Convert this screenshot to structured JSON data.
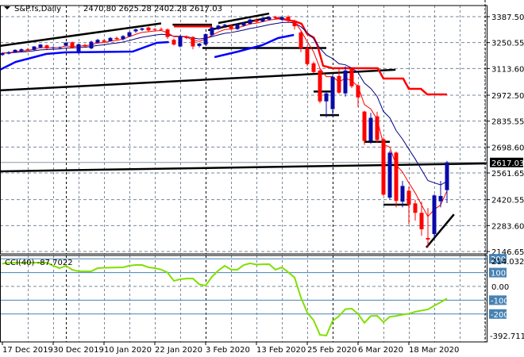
{
  "header": {
    "symbol_timeframe": "S&P.fs,Daily",
    "ohlc": "2470.80 2625.28 2402.28 2617.03"
  },
  "chart_data": {
    "type": "candlestick",
    "title": "S&P.fs,Daily",
    "colors": {
      "bull": "#0a0aa8",
      "bear": "#ff0000",
      "fast_ma": "#ff0000",
      "slow_ma": "#000080",
      "thick_blue": "#0000ff",
      "thick_red": "#ff0000",
      "cci": "#7fe000",
      "cci_level": "#4682b4",
      "grid": "#778899",
      "lines": "#000000"
    },
    "price_axis": {
      "ylim": [
        2146.65,
        3387.5
      ],
      "tick_labels": [
        "3387.50",
        "3250.55",
        "3113.60",
        "2972.50",
        "2835.55",
        "2698.60",
        "2561.65",
        "2420.55",
        "2283.60",
        "2146.65"
      ],
      "current_price": "2617.03"
    },
    "x_labels": [
      {
        "label": "17 Dec 2019",
        "bar": 0
      },
      {
        "label": "30 Dec 2019",
        "bar": 8
      },
      {
        "label": "10 Jan 2020",
        "bar": 16
      },
      {
        "label": "22 Jan 2020",
        "bar": 24
      },
      {
        "label": "3 Feb 2020",
        "bar": 32
      },
      {
        "label": "13 Feb 2020",
        "bar": 40
      },
      {
        "label": "25 Feb 2020",
        "bar": 48
      },
      {
        "label": "6 Mar 2020",
        "bar": 56
      },
      {
        "label": "18 Mar 2020",
        "bar": 64
      }
    ],
    "bars_ohlc": [
      [
        3185,
        3200,
        3180,
        3195
      ],
      [
        3192,
        3205,
        3188,
        3200
      ],
      [
        3200,
        3215,
        3196,
        3212
      ],
      [
        3205,
        3220,
        3200,
        3215
      ],
      [
        3215,
        3222,
        3208,
        3214
      ],
      [
        3212,
        3232,
        3208,
        3230
      ],
      [
        3225,
        3243,
        3220,
        3240
      ],
      [
        3236,
        3240,
        3215,
        3220
      ],
      [
        3224,
        3230,
        3215,
        3226
      ],
      [
        3222,
        3230,
        3218,
        3226
      ],
      [
        3235,
        3253,
        3230,
        3250
      ],
      [
        3252,
        3256,
        3218,
        3222
      ],
      [
        3205,
        3245,
        3190,
        3242
      ],
      [
        3238,
        3244,
        3225,
        3230
      ],
      [
        3220,
        3260,
        3215,
        3255
      ],
      [
        3250,
        3270,
        3245,
        3265
      ],
      [
        3262,
        3268,
        3250,
        3255
      ],
      [
        3258,
        3280,
        3255,
        3275
      ],
      [
        3275,
        3282,
        3265,
        3268
      ],
      [
        3268,
        3290,
        3262,
        3285
      ],
      [
        3283,
        3310,
        3280,
        3305
      ],
      [
        3310,
        3325,
        3302,
        3320
      ],
      [
        3318,
        3330,
        3312,
        3325
      ],
      [
        3330,
        3335,
        3310,
        3315
      ],
      [
        3322,
        3328,
        3315,
        3320
      ],
      [
        3322,
        3330,
        3312,
        3318
      ],
      [
        3320,
        3325,
        3270,
        3280
      ],
      [
        3265,
        3272,
        3235,
        3240
      ],
      [
        3230,
        3290,
        3225,
        3283
      ],
      [
        3282,
        3288,
        3268,
        3274
      ],
      [
        3280,
        3284,
        3215,
        3230
      ],
      [
        3233,
        3250,
        3225,
        3245
      ],
      [
        3240,
        3300,
        3236,
        3295
      ],
      [
        3290,
        3335,
        3285,
        3330
      ],
      [
        3322,
        3345,
        3318,
        3340
      ],
      [
        3340,
        3350,
        3330,
        3345
      ],
      [
        3340,
        3348,
        3318,
        3325
      ],
      [
        3322,
        3350,
        3318,
        3345
      ],
      [
        3340,
        3360,
        3335,
        3355
      ],
      [
        3350,
        3378,
        3345,
        3372
      ],
      [
        3370,
        3380,
        3352,
        3360
      ],
      [
        3362,
        3385,
        3358,
        3378
      ],
      [
        3372,
        3390,
        3368,
        3385
      ],
      [
        3385,
        3392,
        3375,
        3383
      ],
      [
        3372,
        3390,
        3368,
        3385
      ],
      [
        3387,
        3395,
        3355,
        3366
      ],
      [
        3366,
        3372,
        3320,
        3337
      ],
      [
        3304,
        3310,
        3200,
        3220
      ],
      [
        3220,
        3235,
        3125,
        3137
      ],
      [
        3141,
        3150,
        3090,
        3095
      ],
      [
        3103,
        3110,
        2930,
        2940
      ],
      [
        2940,
        2990,
        2855,
        2982
      ],
      [
        2899,
        3080,
        2860,
        3070
      ],
      [
        3074,
        3115,
        2980,
        2986
      ],
      [
        2982,
        3125,
        2965,
        3103
      ],
      [
        3112,
        3118,
        3010,
        3020
      ],
      [
        3024,
        3030,
        2910,
        2961
      ],
      [
        2886,
        2890,
        2710,
        2731
      ],
      [
        2731,
        2880,
        2715,
        2853
      ],
      [
        2861,
        2885,
        2720,
        2736
      ],
      [
        2740,
        2750,
        2440,
        2447
      ],
      [
        2431,
        2680,
        2420,
        2669
      ],
      [
        2669,
        2675,
        2380,
        2414
      ],
      [
        2410,
        2520,
        2380,
        2493
      ],
      [
        2468,
        2490,
        2290,
        2393
      ],
      [
        2401,
        2420,
        2310,
        2351
      ],
      [
        2351,
        2410,
        2230,
        2264
      ],
      [
        2218,
        2376,
        2168,
        2210
      ],
      [
        2239,
        2450,
        2215,
        2443
      ],
      [
        2412,
        2520,
        2380,
        2440
      ],
      [
        2470.8,
        2625.28,
        2402.28,
        2617.03
      ]
    ],
    "thick_blue_line": [
      [
        [
          -0.4,
          3106.6
        ],
        [
          2.1,
          3148.4
        ],
        [
          5,
          3173.7
        ],
        [
          6.9,
          3190.5
        ],
        [
          9.9,
          3198.9
        ],
        [
          20.5,
          3203.1
        ],
        [
          24.3,
          3249.2
        ],
        [
          26.2,
          3253.4
        ]
      ],
      [
        [
          33.4,
          3173.7
        ],
        [
          37.1,
          3203.1
        ],
        [
          40.9,
          3236.6
        ],
        [
          43.4,
          3274.3
        ],
        [
          45.9,
          3291.1
        ]
      ]
    ],
    "thick_red_line": [
      [
        42.8,
        3383
      ],
      [
        46.1,
        3362
      ],
      [
        47.1,
        3350
      ],
      [
        48,
        3295
      ],
      [
        49,
        3278
      ],
      [
        49.6,
        3236.6
      ],
      [
        50.5,
        3127.6
      ],
      [
        52,
        3115
      ],
      [
        59.1,
        3115
      ],
      [
        60,
        3060.5
      ],
      [
        63.1,
        3060.5
      ],
      [
        64,
        3006
      ],
      [
        65.9,
        3006
      ],
      [
        66.9,
        2976.7
      ],
      [
        70,
        2976.7
      ]
    ],
    "drawn_lines": [
      {
        "name": "upper-trendline",
        "from": [
          -0.4,
          3233
        ],
        "to": [
          25,
          3352
        ]
      },
      {
        "name": "top-channel-upper",
        "from": [
          34,
          3354
        ],
        "to": [
          42,
          3404
        ]
      },
      {
        "name": "top-channel-lower",
        "from": [
          32.4,
          3316
        ],
        "to": [
          42,
          3383
        ]
      },
      {
        "name": "top-resistance",
        "from": [
          26.8,
          3345
        ],
        "to": [
          33,
          3345
        ]
      },
      {
        "name": "support-3220",
        "from": [
          31.5,
          3222
        ],
        "to": [
          51,
          3222
        ]
      },
      {
        "name": "long-rising-line",
        "from": [
          -0.4,
          2998
        ],
        "to": [
          61.9,
          3107
        ]
      },
      {
        "name": "support-2990",
        "from": [
          49,
          2992
        ],
        "to": [
          52,
          2992
        ]
      },
      {
        "name": "support-2865",
        "from": [
          50,
          2867
        ],
        "to": [
          53,
          2867
        ]
      },
      {
        "name": "support-2727",
        "from": [
          57,
          2726
        ],
        "to": [
          61,
          2726
        ]
      },
      {
        "name": "support-2393",
        "from": [
          60,
          2394
        ],
        "to": [
          64,
          2394
        ]
      },
      {
        "name": "long-flat-line",
        "from": [
          -0.4,
          2570
        ],
        "to": [
          76.2,
          2612
        ]
      },
      {
        "name": "bottom-trendline",
        "from": [
          66.75,
          2168
        ],
        "to": [
          71.1,
          2343
        ]
      }
    ],
    "drawn_red_lines": [
      {
        "name": "red-resistance",
        "from": [
          27,
          3336
        ],
        "to": [
          33,
          3336
        ]
      }
    ],
    "cci": {
      "label": "CCI(40) -87.7022",
      "ylim": [
        -392.7112,
        214.0323
      ],
      "levels": [
        200,
        100,
        -100,
        -200
      ],
      "tick_labels": {
        "top": "214.0323",
        "l200": "200",
        "l100": "100",
        "zero": "0.00",
        "m100": "-100",
        "m200": "-200",
        "bottom": "-392.7112"
      },
      "values": [
        165,
        170,
        172,
        172,
        172,
        172,
        172,
        172,
        150,
        132,
        149,
        120,
        109,
        109,
        109,
        132,
        135,
        136,
        137,
        138,
        150,
        155,
        155,
        138,
        132,
        122,
        100,
        40,
        52,
        57,
        57,
        15,
        6,
        70,
        115,
        149,
        122,
        121,
        155,
        167,
        158,
        160,
        161,
        121,
        138,
        103,
        65,
        -80,
        -190,
        -245,
        -351,
        -356,
        -250,
        -215,
        -165,
        -161,
        -200,
        -264,
        -215,
        -213,
        -259,
        -220,
        -214,
        -205,
        -198,
        -184,
        -175,
        -167,
        -140,
        -115,
        -87.7022
      ]
    }
  }
}
